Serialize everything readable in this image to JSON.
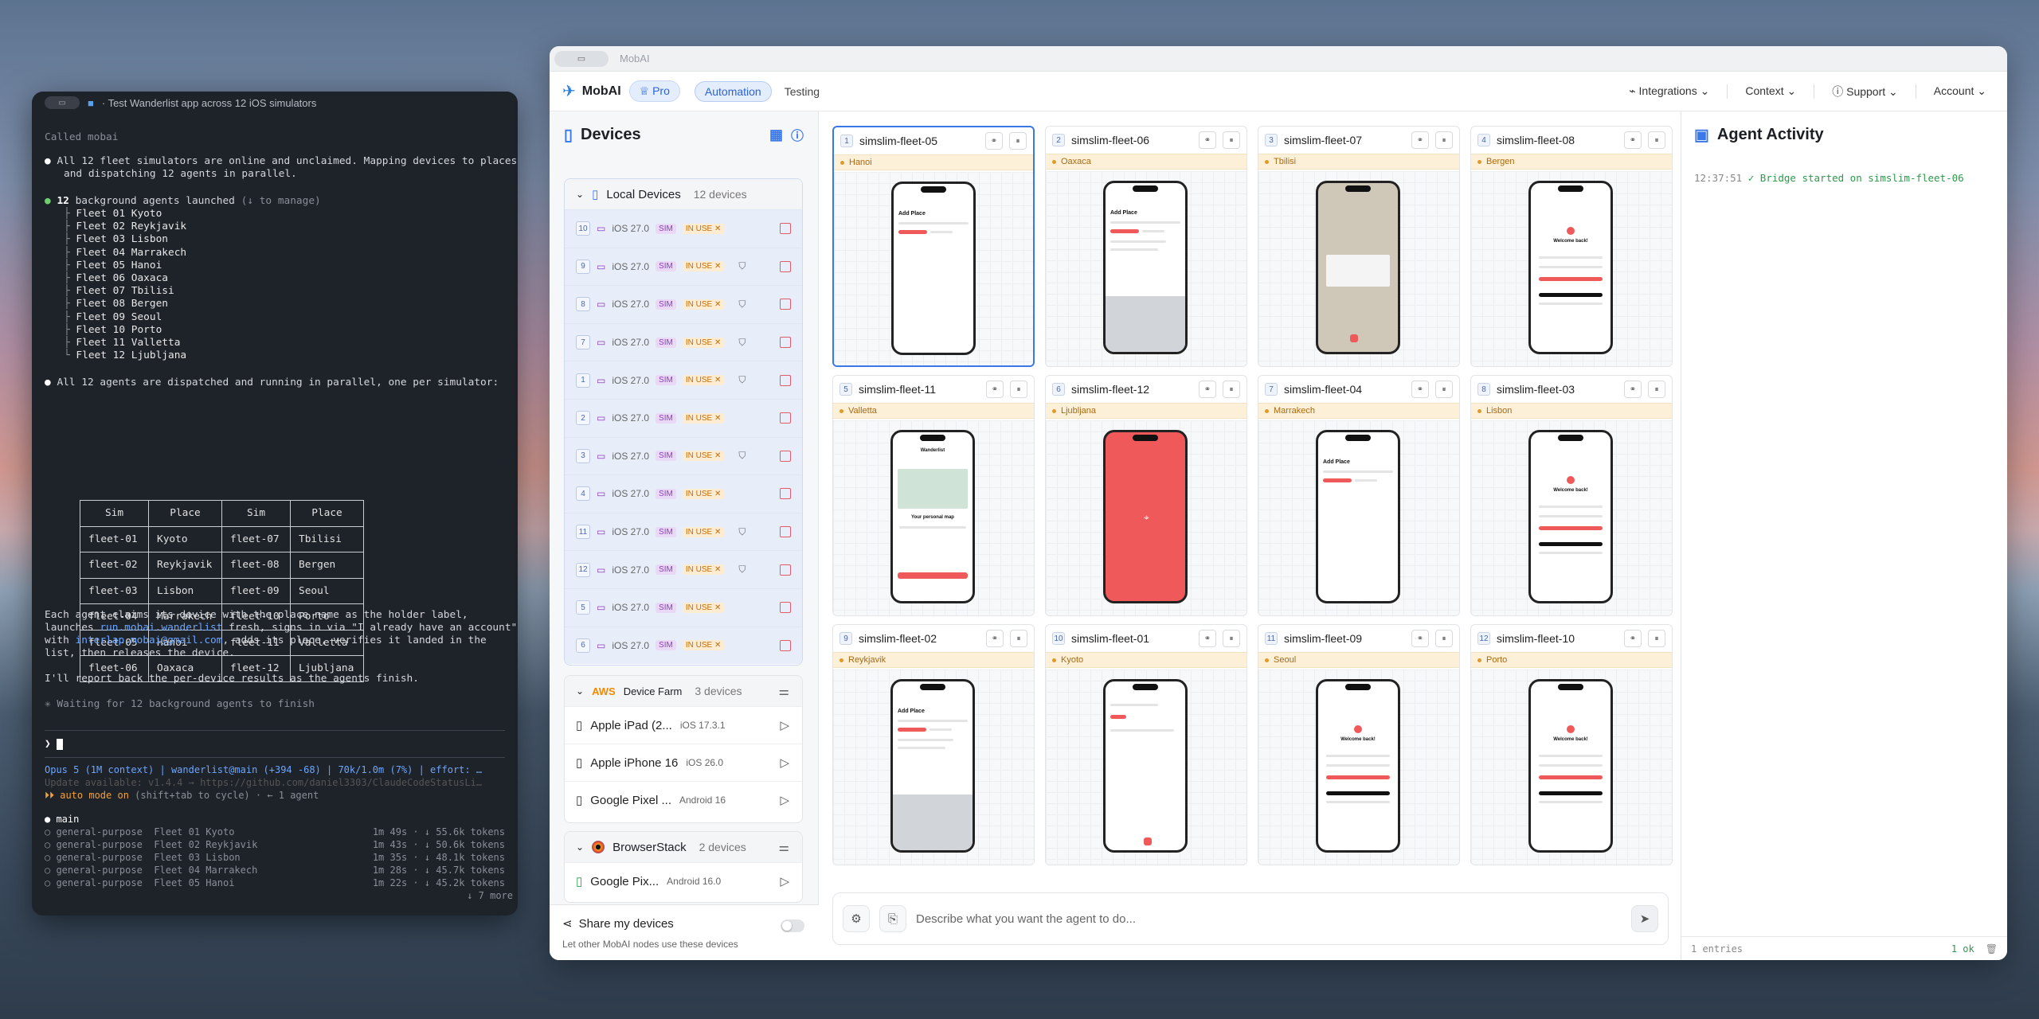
{
  "terminal": {
    "title": "· Test Wanderlist app across 12 iOS simulators",
    "called": "Called mobai",
    "msg1a": "All 12 fleet simulators are online and unclaimed. Mapping devices to places",
    "msg1b": "and dispatching 12 agents in parallel.",
    "launched_count": "12",
    "launched_text": " background agents launched ",
    "launched_hint": "(↓ to manage)",
    "fleet": [
      "Fleet 01 Kyoto",
      "Fleet 02 Reykjavik",
      "Fleet 03 Lisbon",
      "Fleet 04 Marrakech",
      "Fleet 05 Hanoi",
      "Fleet 06 Oaxaca",
      "Fleet 07 Tbilisi",
      "Fleet 08 Bergen",
      "Fleet 09 Seoul",
      "Fleet 10 Porto",
      "Fleet 11 Valletta",
      "Fleet 12 Ljubljana"
    ],
    "dispatched": "All 12 agents are dispatched and running in parallel, one per simulator:",
    "table_head": [
      "Sim",
      "Place",
      "Sim",
      "Place"
    ],
    "table_rows": [
      [
        "fleet-01",
        "Kyoto",
        "fleet-07",
        "Tbilisi"
      ],
      [
        "fleet-02",
        "Reykjavik",
        "fleet-08",
        "Bergen"
      ],
      [
        "fleet-03",
        "Lisbon",
        "fleet-09",
        "Seoul"
      ],
      [
        "fleet-04",
        "Marrakech",
        "fleet-10",
        "Porto"
      ],
      [
        "fleet-05",
        "Hanoi",
        "fleet-11",
        "Valletta"
      ],
      [
        "fleet-06",
        "Oaxaca",
        "fleet-12",
        "Ljubljana"
      ]
    ],
    "p1": "Each agent claims its device with the place name as the holder label,",
    "p2a": "launches ",
    "p2link": "run.mobai.wanderlist",
    "p2b": " fresh, signs in via \"I already have an account\"",
    "p3a": "with ",
    "p3link": "interlap.mobai@gmail.com",
    "p3b": ", adds its place, verifies it landed in the",
    "p4": "list, then releases the device.",
    "p5": "I'll report back the per-device results as the agents finish.",
    "waiting": "✳ Waiting for 12 background agents to finish",
    "prompt": "❯ ",
    "status": "Opus 5 (1M context) | wanderlist@main (+394 -68) | 70k/1.0m (7%) | effort: …",
    "update": "Update available: v1.4.4 → https://github.com/daniel3303/ClaudeCodeStatusLi…",
    "auto": "⏵⏵ auto mode on",
    "auto_hint": " (shift+tab to cycle) · ← 1 agent",
    "main": "main",
    "agents": [
      {
        "name": "general-purpose  Fleet 01 Kyoto",
        "time": "1m 49s · ↓ 55.6k tokens"
      },
      {
        "name": "general-purpose  Fleet 02 Reykjavik",
        "time": "1m 43s · ↓ 50.6k tokens"
      },
      {
        "name": "general-purpose  Fleet 03 Lisbon",
        "time": "1m 35s · ↓ 48.1k tokens"
      },
      {
        "name": "general-purpose  Fleet 04 Marrakech",
        "time": "1m 28s · ↓ 45.7k tokens"
      },
      {
        "name": "general-purpose  Fleet 05 Hanoi",
        "time": "1m 22s · ↓ 45.2k tokens"
      }
    ],
    "more": "↓ 7 more"
  },
  "app": {
    "window_title": "MobAI",
    "logo": "MobAI",
    "pro": "Pro",
    "tabs": [
      "Automation",
      "Testing"
    ],
    "nav_right": [
      "Integrations",
      "Context",
      "Support",
      "Account"
    ],
    "devices_title": "Devices",
    "local": {
      "label": "Local Devices",
      "count": "12 devices",
      "rows": [
        {
          "n": "10",
          "os": "iOS 27.0",
          "sim": "SIM",
          "use": "IN USE ✕"
        },
        {
          "n": "9",
          "os": "iOS 27.0",
          "sim": "SIM",
          "use": "IN USE ✕"
        },
        {
          "n": "8",
          "os": "iOS 27.0",
          "sim": "SIM",
          "use": "IN USE ✕"
        },
        {
          "n": "7",
          "os": "iOS 27.0",
          "sim": "SIM",
          "use": "IN USE ✕"
        },
        {
          "n": "1",
          "os": "iOS 27.0",
          "sim": "SIM",
          "use": "IN USE ✕"
        },
        {
          "n": "2",
          "os": "iOS 27.0",
          "sim": "SIM",
          "use": "IN USE ✕"
        },
        {
          "n": "3",
          "os": "iOS 27.0",
          "sim": "SIM",
          "use": "IN USE ✕"
        },
        {
          "n": "4",
          "os": "iOS 27.0",
          "sim": "SIM",
          "use": "IN USE ✕"
        },
        {
          "n": "11",
          "os": "iOS 27.0",
          "sim": "SIM",
          "use": "IN USE ✕"
        },
        {
          "n": "12",
          "os": "iOS 27.0",
          "sim": "SIM",
          "use": "IN USE ✕"
        },
        {
          "n": "5",
          "os": "iOS 27.0",
          "sim": "SIM",
          "use": "IN USE ✕"
        },
        {
          "n": "6",
          "os": "iOS 27.0",
          "sim": "SIM",
          "use": "IN USE ✕"
        }
      ]
    },
    "aws": {
      "brand": "AWS",
      "label": "Device Farm",
      "count": "3 devices",
      "rows": [
        {
          "name": "Apple iPad (2...",
          "ver": "iOS 17.3.1"
        },
        {
          "name": "Apple iPhone 16",
          "ver": "iOS 26.0"
        },
        {
          "name": "Google Pixel ...",
          "ver": "Android 16"
        }
      ]
    },
    "bs": {
      "label": "BrowserStack",
      "count": "2 devices",
      "rows": [
        {
          "name": "Google Pix...",
          "ver": "Android 16.0"
        }
      ]
    },
    "share_title": "Share my devices",
    "share_sub": "Let other MobAI nodes use these devices",
    "cards": [
      {
        "n": "1",
        "name": "simslim-fleet-05",
        "place": "Hanoi",
        "screen": "add"
      },
      {
        "n": "2",
        "name": "simslim-fleet-06",
        "place": "Oaxaca",
        "screen": "addkb"
      },
      {
        "n": "3",
        "name": "simslim-fleet-07",
        "place": "Tbilisi",
        "screen": "map"
      },
      {
        "n": "4",
        "name": "simslim-fleet-08",
        "place": "Bergen",
        "screen": "welcome"
      },
      {
        "n": "5",
        "name": "simslim-fleet-11",
        "place": "Valletta",
        "screen": "personal"
      },
      {
        "n": "6",
        "name": "simslim-fleet-12",
        "place": "Ljubljana",
        "screen": "red"
      },
      {
        "n": "7",
        "name": "simslim-fleet-04",
        "place": "Marrakech",
        "screen": "add"
      },
      {
        "n": "8",
        "name": "simslim-fleet-03",
        "place": "Lisbon",
        "screen": "welcome"
      },
      {
        "n": "9",
        "name": "simslim-fleet-02",
        "place": "Reykjavik",
        "screen": "addkb"
      },
      {
        "n": "10",
        "name": "simslim-fleet-01",
        "place": "Kyoto",
        "screen": "list"
      },
      {
        "n": "11",
        "name": "simslim-fleet-09",
        "place": "Seoul",
        "screen": "welcome"
      },
      {
        "n": "12",
        "name": "simslim-fleet-10",
        "place": "Porto",
        "screen": "welcome"
      }
    ],
    "phone_text": {
      "add": "Add Place",
      "welcome": "Welcome back!",
      "personal": "Your personal map",
      "wander": "Wanderlist"
    },
    "prompt_placeholder": "Describe what you want the agent to do...",
    "agent_title": "Agent Activity",
    "log": [
      {
        "time": "12:37:51",
        "text": "✓ Bridge started on simslim-fleet-06"
      }
    ],
    "entries": "1 entries",
    "ok": "1 ok"
  }
}
